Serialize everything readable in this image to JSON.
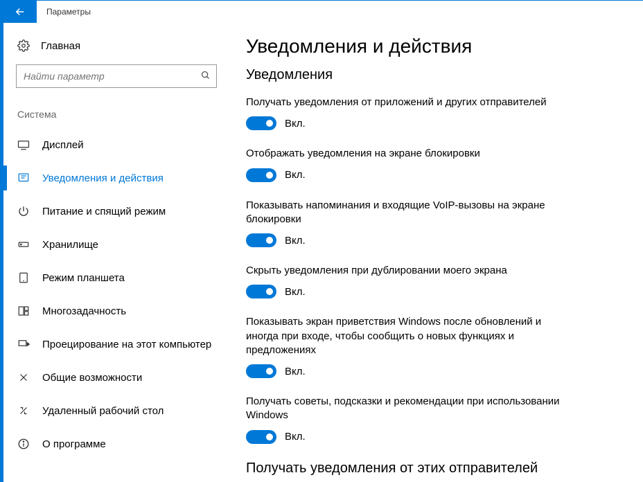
{
  "window": {
    "title": "Параметры"
  },
  "sidebar": {
    "home": "Главная",
    "search_placeholder": "Найти параметр",
    "section": "Система",
    "items": [
      {
        "label": "Дисплей"
      },
      {
        "label": "Уведомления и действия"
      },
      {
        "label": "Питание и спящий режим"
      },
      {
        "label": "Хранилище"
      },
      {
        "label": "Режим планшета"
      },
      {
        "label": "Многозадачность"
      },
      {
        "label": "Проецирование на этот компьютер"
      },
      {
        "label": "Общие возможности"
      },
      {
        "label": "Удаленный рабочий стол"
      },
      {
        "label": "О программе"
      }
    ]
  },
  "main": {
    "title": "Уведомления и действия",
    "subtitle": "Уведомления",
    "toggle_on": "Вкл.",
    "settings": [
      {
        "label": "Получать уведомления от приложений и других отправителей"
      },
      {
        "label": "Отображать уведомления на экране блокировки"
      },
      {
        "label": "Показывать напоминания и входящие VoIP-вызовы на экране блокировки"
      },
      {
        "label": "Скрыть уведомления при дублировании моего экрана"
      },
      {
        "label": "Показывать экран приветствия Windows после обновлений и иногда при входе, чтобы сообщить о новых функциях и предложениях"
      },
      {
        "label": "Получать советы, подсказки и рекомендации при использовании Windows"
      }
    ],
    "footer_title": "Получать уведомления от этих отправителей"
  }
}
